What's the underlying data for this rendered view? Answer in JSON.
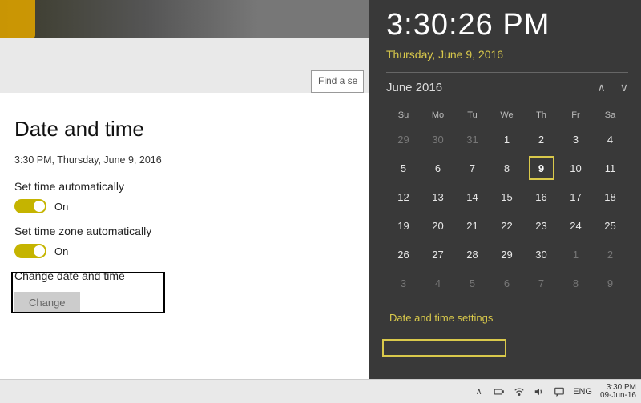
{
  "header": {
    "search_placeholder": "Find a se"
  },
  "settings": {
    "title": "Date and time",
    "current": "3:30 PM, Thursday, June 9, 2016",
    "set_time_auto": {
      "label": "Set time automatically",
      "state": "On",
      "on": true
    },
    "set_zone_auto": {
      "label": "Set time zone automatically",
      "state": "On",
      "on": true
    },
    "change_section": {
      "label": "Change date and time",
      "button": "Change"
    }
  },
  "flyout": {
    "time": "3:30:26 PM",
    "date": "Thursday, June 9, 2016",
    "month_label": "June 2016",
    "dow": [
      "Su",
      "Mo",
      "Tu",
      "We",
      "Th",
      "Fr",
      "Sa"
    ],
    "weeks": [
      [
        {
          "n": "29",
          "dim": true
        },
        {
          "n": "30",
          "dim": true
        },
        {
          "n": "31",
          "dim": true
        },
        {
          "n": "1"
        },
        {
          "n": "2"
        },
        {
          "n": "3"
        },
        {
          "n": "4"
        }
      ],
      [
        {
          "n": "5"
        },
        {
          "n": "6"
        },
        {
          "n": "7"
        },
        {
          "n": "8"
        },
        {
          "n": "9",
          "today": true
        },
        {
          "n": "10"
        },
        {
          "n": "11"
        }
      ],
      [
        {
          "n": "12"
        },
        {
          "n": "13"
        },
        {
          "n": "14"
        },
        {
          "n": "15"
        },
        {
          "n": "16"
        },
        {
          "n": "17"
        },
        {
          "n": "18"
        }
      ],
      [
        {
          "n": "19"
        },
        {
          "n": "20"
        },
        {
          "n": "21"
        },
        {
          "n": "22"
        },
        {
          "n": "23"
        },
        {
          "n": "24"
        },
        {
          "n": "25"
        }
      ],
      [
        {
          "n": "26"
        },
        {
          "n": "27"
        },
        {
          "n": "28"
        },
        {
          "n": "29"
        },
        {
          "n": "30"
        },
        {
          "n": "1",
          "dim": true
        },
        {
          "n": "2",
          "dim": true
        }
      ],
      [
        {
          "n": "3",
          "dim": true
        },
        {
          "n": "4",
          "dim": true
        },
        {
          "n": "5",
          "dim": true
        },
        {
          "n": "6",
          "dim": true
        },
        {
          "n": "7",
          "dim": true
        },
        {
          "n": "8",
          "dim": true
        },
        {
          "n": "9",
          "dim": true
        }
      ]
    ],
    "link": "Date and time settings"
  },
  "taskbar": {
    "lang": "ENG",
    "clock_time": "3:30 PM",
    "clock_date": "09-Jun-16"
  }
}
